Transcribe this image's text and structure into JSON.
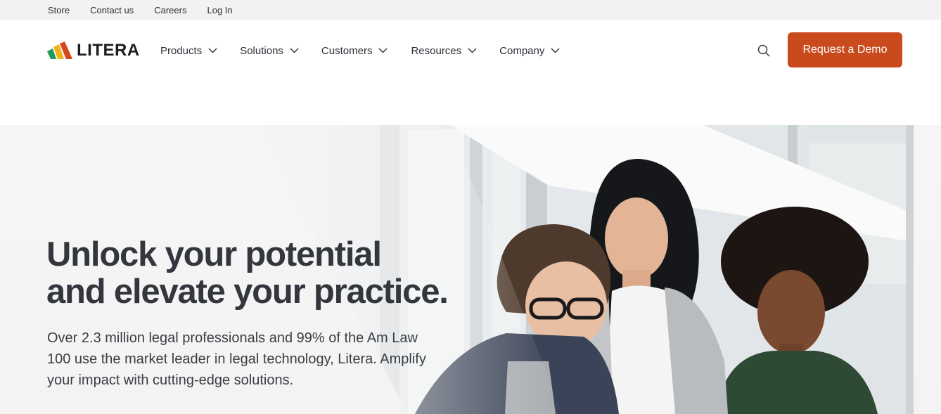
{
  "utility_nav": [
    "Store",
    "Contact us",
    "Careers",
    "Log In"
  ],
  "brand": {
    "name": "LITERA",
    "logo_colors": [
      "#1f9a5c",
      "#f2b21b",
      "#d7471e"
    ]
  },
  "nav": {
    "products": "Products",
    "solutions": "Solutions",
    "customers": "Customers",
    "resources": "Resources",
    "company": "Company"
  },
  "search_icon": "search-icon",
  "cta": {
    "label": "Request a Demo",
    "color": "#c94a1c"
  },
  "hero": {
    "title_line1": "Unlock your potential",
    "title_line2": "and elevate your practice.",
    "subtitle": "Over 2.3 million legal professionals and 99% of the Am Law 100 use the market leader in legal technology, Litera. Amplify your impact with cutting-edge solutions."
  }
}
